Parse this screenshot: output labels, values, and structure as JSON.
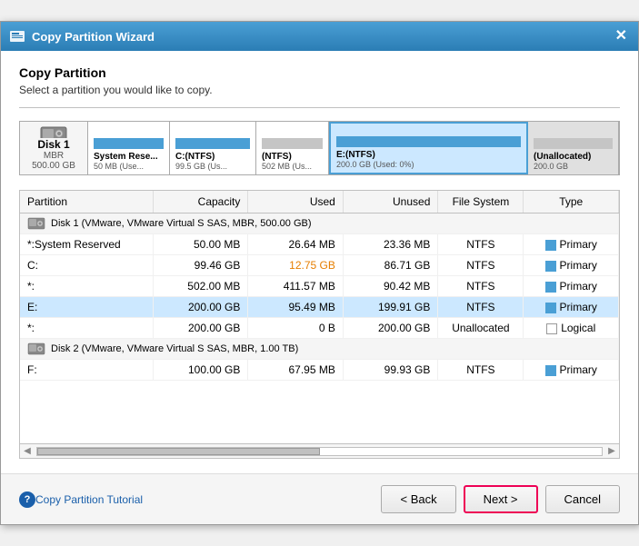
{
  "window": {
    "title": "Copy Partition Wizard",
    "close_label": "✕"
  },
  "header": {
    "title": "Copy Partition",
    "subtitle": "Select a partition you would like to copy."
  },
  "disk_visual": {
    "label_name": "Disk 1",
    "label_sub": "MBR\n500.00 GB",
    "partitions": [
      {
        "name": "System Rese",
        "info": "50 MB (Use...",
        "bar_pct": 55,
        "selected": false,
        "gray": false
      },
      {
        "name": "C:(NTFS)",
        "info": "99.5 GB (Us...",
        "bar_pct": 15,
        "selected": false,
        "gray": false
      },
      {
        "name": "(NTFS)",
        "info": "502 MB (Us...",
        "bar_pct": 85,
        "selected": false,
        "gray": false
      },
      {
        "name": "E:(NTFS)",
        "info": "200.0 GB (Used: 0%)",
        "bar_pct": 5,
        "selected": true,
        "gray": false
      },
      {
        "name": "(Unallocated)",
        "info": "200.0 GB",
        "bar_pct": 0,
        "selected": false,
        "gray": true
      }
    ]
  },
  "table": {
    "columns": [
      "Partition",
      "Capacity",
      "Used",
      "Unused",
      "File System",
      "Type"
    ],
    "groups": [
      {
        "header": "Disk 1 (VMware, VMware Virtual S SAS, MBR, 500.00 GB)",
        "rows": [
          {
            "partition": "*:System Reserved",
            "capacity": "50.00 MB",
            "used": "26.64 MB",
            "unused": "23.36 MB",
            "fs": "NTFS",
            "type": "Primary",
            "selected": false,
            "used_orange": false
          },
          {
            "partition": "C:",
            "capacity": "99.46 GB",
            "used": "12.75 GB",
            "unused": "86.71 GB",
            "fs": "NTFS",
            "type": "Primary",
            "selected": false,
            "used_orange": true
          },
          {
            "partition": "*:",
            "capacity": "502.00 MB",
            "used": "411.57 MB",
            "unused": "90.42 MB",
            "fs": "NTFS",
            "type": "Primary",
            "selected": false,
            "used_orange": false
          },
          {
            "partition": "E:",
            "capacity": "200.00 GB",
            "used": "95.49 MB",
            "unused": "199.91 GB",
            "fs": "NTFS",
            "type": "Primary",
            "selected": true,
            "used_orange": false
          },
          {
            "partition": "*:",
            "capacity": "200.00 GB",
            "used": "0 B",
            "unused": "200.00 GB",
            "fs": "Unallocated",
            "type": "Logical",
            "selected": false,
            "used_orange": false
          }
        ]
      },
      {
        "header": "Disk 2 (VMware, VMware Virtual S SAS, MBR, 1.00 TB)",
        "rows": [
          {
            "partition": "F:",
            "capacity": "100.00 GB",
            "used": "67.95 MB",
            "unused": "99.93 GB",
            "fs": "NTFS",
            "type": "Primary",
            "selected": false,
            "used_orange": false
          }
        ]
      }
    ]
  },
  "footer": {
    "help_icon": "?",
    "tutorial_link": "Copy Partition Tutorial",
    "back_label": "< Back",
    "next_label": "Next >",
    "cancel_label": "Cancel"
  }
}
